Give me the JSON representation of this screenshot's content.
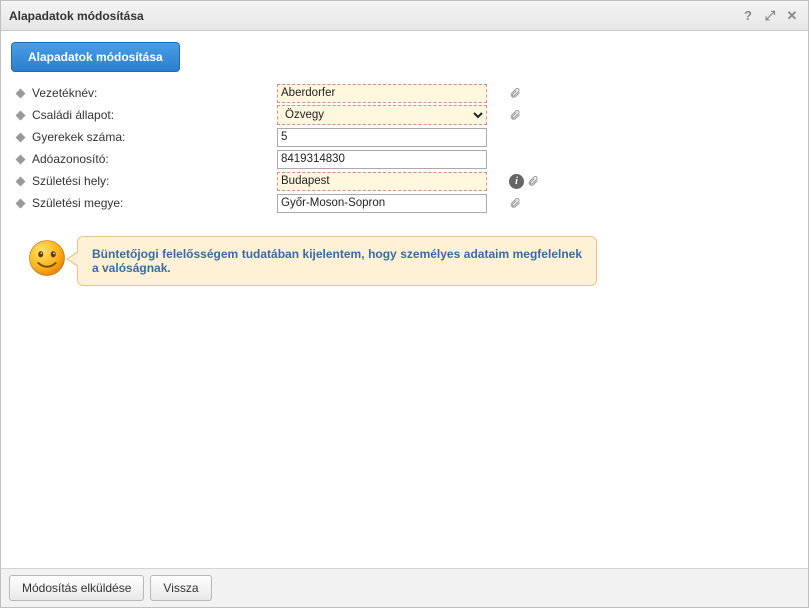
{
  "window": {
    "title": "Alapadatok módosítása"
  },
  "tab": {
    "label": "Alapadatok módosítása"
  },
  "fields": {
    "vezeteknev": {
      "label": "Vezetéknév:",
      "value": "Aberdorfer"
    },
    "csaladi_allapot": {
      "label": "Családi állapot:",
      "value": "Özvegy"
    },
    "gyerekek_szama": {
      "label": "Gyerekek száma:",
      "value": "5"
    },
    "adoazonosito": {
      "label": "Adóazonosító:",
      "value": "8419314830"
    },
    "szuletesi_hely": {
      "label": "Születési hely:",
      "value": "Budapest"
    },
    "szuletesi_megye": {
      "label": "Születési megye:",
      "value": "Győr-Moson-Sopron"
    }
  },
  "declaration": {
    "text": "Büntetőjogi felelősségem tudatában kijelentem, hogy személyes adataim megfelelnek a valóságnak."
  },
  "footer": {
    "submit": "Módosítás elküldése",
    "back": "Vissza"
  },
  "titlebar_icons": {
    "help": "?",
    "max": "⤢",
    "close": "✕"
  },
  "colors": {
    "primary": "#2b7fcc",
    "highlight_bg": "#fff7de",
    "bubble_bg": "#fff1d6",
    "bubble_border": "#e8c684"
  }
}
